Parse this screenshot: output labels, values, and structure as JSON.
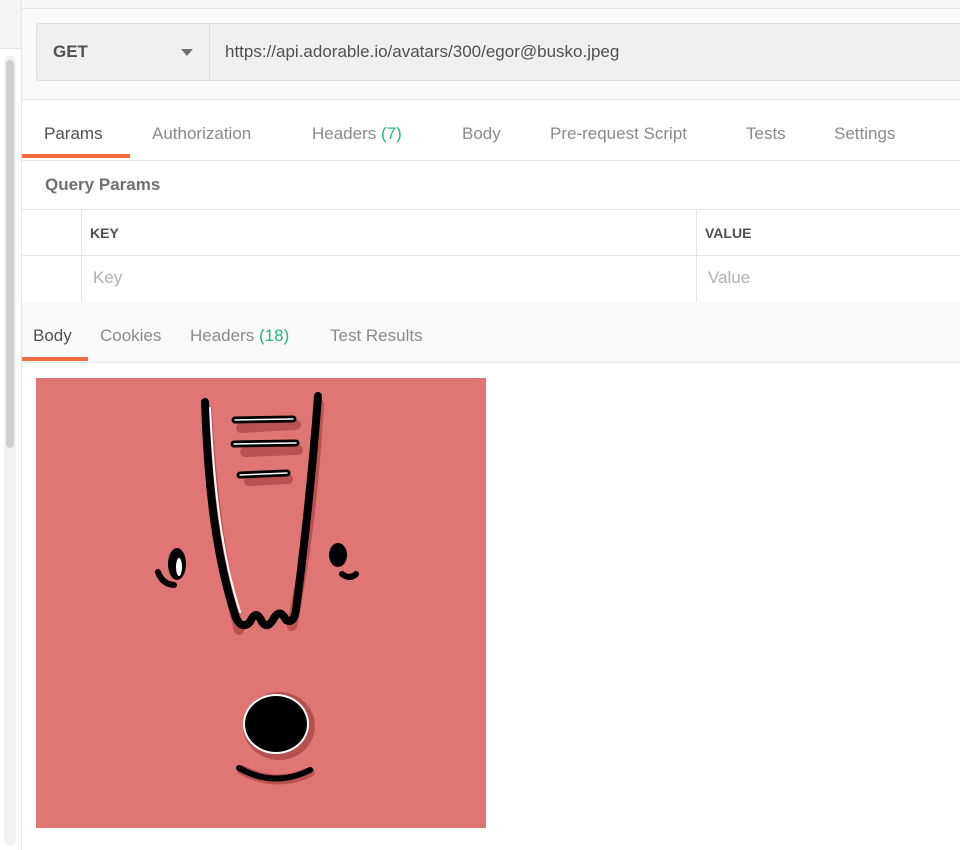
{
  "request": {
    "method": "GET",
    "url": "https://api.adorable.io/avatars/300/egor@busko.jpeg"
  },
  "request_tabs": [
    {
      "label": "Params",
      "count": "",
      "active": true
    },
    {
      "label": "Authorization",
      "count": "",
      "active": false
    },
    {
      "label": "Headers",
      "count": "(7)",
      "active": false
    },
    {
      "label": "Body",
      "count": "",
      "active": false
    },
    {
      "label": "Pre-request Script",
      "count": "",
      "active": false
    },
    {
      "label": "Tests",
      "count": "",
      "active": false
    },
    {
      "label": "Settings",
      "count": "",
      "active": false
    }
  ],
  "query_params": {
    "title": "Query Params",
    "key_header": "KEY",
    "value_header": "VALUE",
    "key_placeholder": "Key",
    "value_placeholder": "Value"
  },
  "response_tabs": [
    {
      "label": "Body",
      "count": "",
      "active": true
    },
    {
      "label": "Cookies",
      "count": "",
      "active": false
    },
    {
      "label": "Headers",
      "count": "(18)",
      "active": false
    },
    {
      "label": "Test Results",
      "count": "",
      "active": false
    }
  ],
  "response_image": {
    "background": "#e07674",
    "feature_color": "#000000",
    "shadow_color": "#b5504f"
  },
  "colors": {
    "accent": "#f26b3a",
    "count": "#26b47f"
  }
}
